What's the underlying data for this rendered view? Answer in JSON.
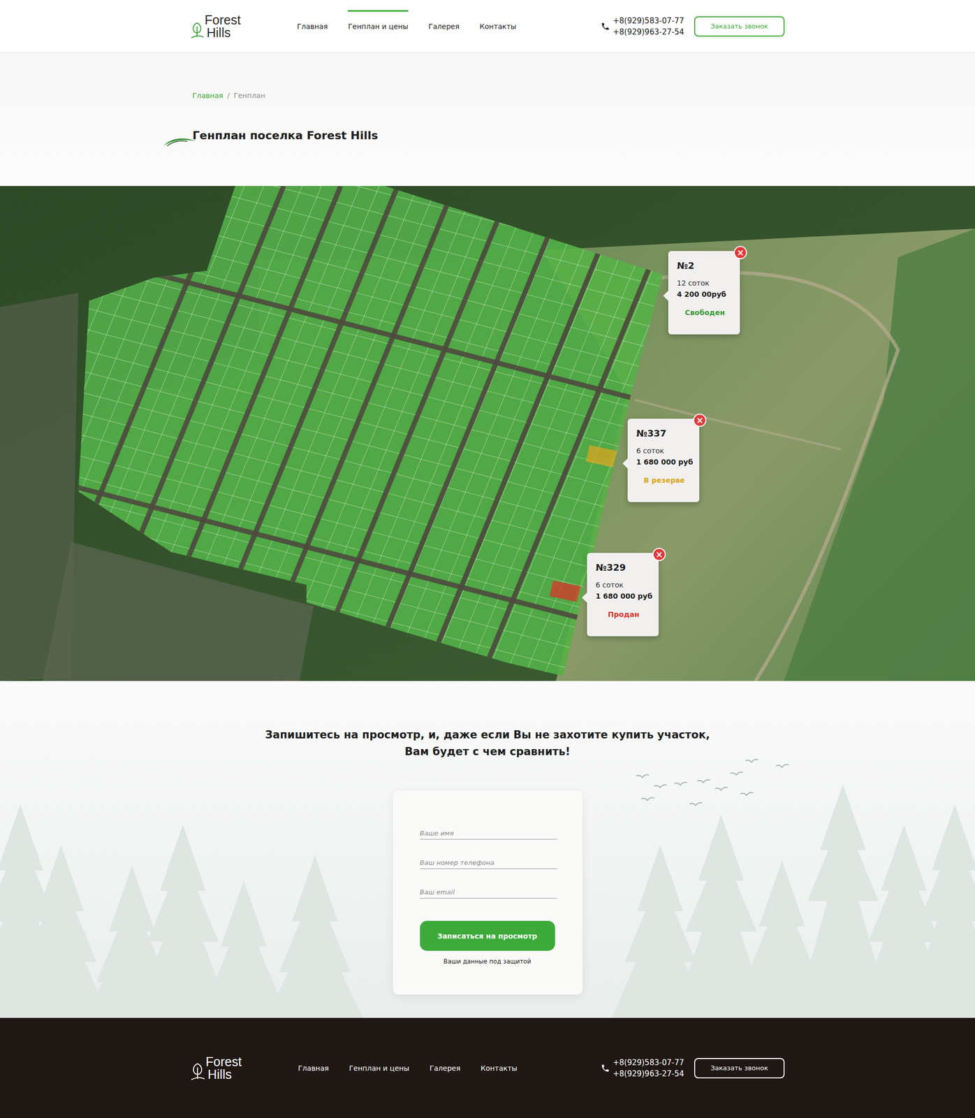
{
  "header": {
    "logo": {
      "line1": "Forest",
      "line2": "Hills"
    },
    "nav": [
      {
        "label": "Главная",
        "selected": false
      },
      {
        "label": "Генплан и цены",
        "selected": true
      },
      {
        "label": "Галерея",
        "selected": false
      },
      {
        "label": "Контакты",
        "selected": false
      }
    ],
    "phones": [
      "+8(929)583-07-77",
      "+8(929)963-27-54"
    ],
    "callback": "Заказать звонок"
  },
  "breadcrumb": [
    {
      "label": "Главная",
      "current": false
    },
    {
      "label": "Генплан",
      "current": true
    }
  ],
  "breadcrumb_separator": "/",
  "title": "Генплан поселка Forest Hills",
  "map": {
    "close": "×",
    "popups": [
      {
        "number": "№2",
        "area": "12 соток",
        "price": "4 200 00руб",
        "status": "Свободен",
        "color": "#3a9a35",
        "highlighted": false
      },
      {
        "number": "№337",
        "area": "6 соток",
        "price": "1 680 000 руб",
        "status": "В резерве",
        "color": "#d9a521",
        "highlighted": true
      },
      {
        "number": "№329",
        "area": "6 соток",
        "price": "1 680 000 руб",
        "status": "Продан",
        "color": "#d9362b",
        "highlighted": true
      }
    ]
  },
  "form": {
    "heading": [
      "Запишитесь на просмотр, и, даже если Вы не захотите купить участок,",
      "Вам будет с чем сравнить!"
    ],
    "fields": [
      "Ваше имя",
      "Ваш номер телефона",
      "Ваш email"
    ],
    "submit": "Записаться на просмотр",
    "note": "Ваши данные под защитой"
  },
  "footer": {
    "logo": {
      "line1": "Forest",
      "line2": "Hills"
    },
    "nav": [
      "Главная",
      "Генплан и цены",
      "Галерея",
      "Контакты"
    ],
    "phones": [
      "+8(929)583-07-77",
      "+8(929)963-27-54"
    ],
    "callback": "Заказать звонок"
  }
}
